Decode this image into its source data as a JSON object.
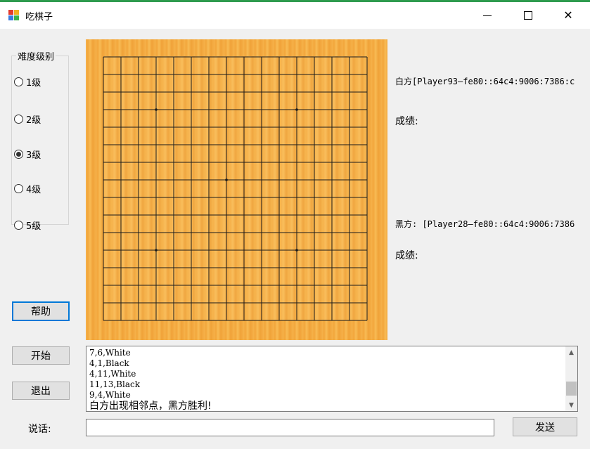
{
  "window": {
    "title": "吃棋子",
    "controls": {
      "minimize": "─",
      "maximize": "☐",
      "close": "✕"
    },
    "icon": "app-icon"
  },
  "levels": {
    "legend": "难度级别",
    "options": [
      {
        "label": "1级",
        "selected": false
      },
      {
        "label": "2级",
        "selected": false
      },
      {
        "label": "3级",
        "selected": true
      },
      {
        "label": "4级",
        "selected": false
      },
      {
        "label": "5级",
        "selected": false
      }
    ]
  },
  "buttons": {
    "help": "帮助",
    "start": "开始",
    "exit": "退出",
    "send": "发送"
  },
  "board": {
    "lines": 16,
    "star_points": [
      [
        3,
        3
      ],
      [
        11,
        3
      ],
      [
        7,
        7
      ],
      [
        3,
        11
      ],
      [
        11,
        11
      ]
    ]
  },
  "players": {
    "white_label": "白方[Player93—fe80::64c4:9006:7386:c",
    "white_score_label": "成绩:",
    "black_label": "黑方: [Player28—fe80::64c4:9006:7386",
    "black_score_label": "成绩:"
  },
  "log": {
    "lines": [
      "7,6,White",
      "4,1,Black",
      "4,11,White",
      "11,13,Black",
      "9,4,White"
    ],
    "result": "白方出现相邻点，黑方胜利!"
  },
  "chat": {
    "label": "说话:",
    "value": ""
  },
  "colors": {
    "accent": "#0078d7",
    "board": "#f5b04a",
    "topstrip": "#2e9b4f"
  }
}
